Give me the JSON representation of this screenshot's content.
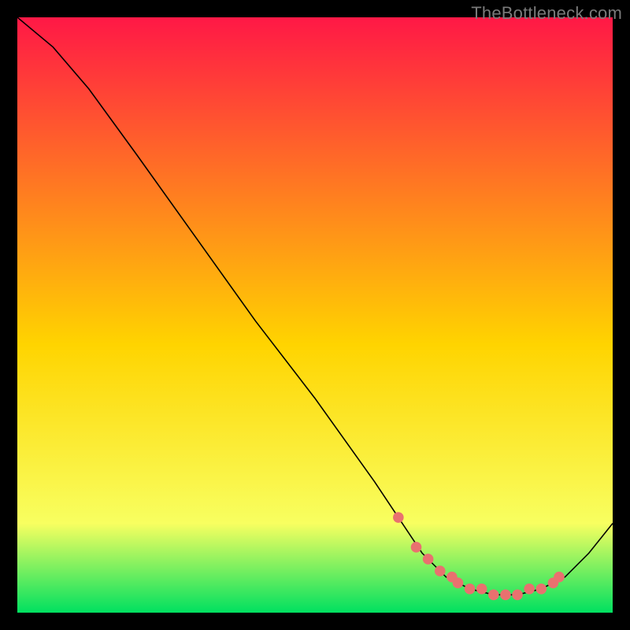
{
  "watermark": "TheBottleneck.com",
  "colors": {
    "bg_black": "#000000",
    "grad_top": "#ff1846",
    "grad_mid": "#ffd400",
    "grad_low": "#f8ff60",
    "grad_bottom": "#00e060",
    "curve": "#000000",
    "marker": "#e9716f",
    "watermark": "#7a7a7a"
  },
  "chart_data": {
    "type": "line",
    "title": "",
    "xlabel": "",
    "ylabel": "",
    "xlim": [
      0,
      100
    ],
    "ylim": [
      0,
      100
    ],
    "series": [
      {
        "name": "curve",
        "x": [
          0,
          6,
          12,
          20,
          30,
          40,
          50,
          60,
          64,
          68,
          72,
          76,
          80,
          84,
          88,
          92,
          96,
          100
        ],
        "values": [
          100,
          95,
          88,
          77,
          63,
          49,
          36,
          22,
          16,
          10,
          6,
          4,
          3,
          3,
          4,
          6,
          10,
          15
        ]
      }
    ],
    "markers": {
      "name": "highlighted-points",
      "x": [
        64,
        67,
        69,
        71,
        73,
        74,
        76,
        78,
        80,
        82,
        84,
        86,
        88,
        90,
        91
      ],
      "values": [
        16,
        11,
        9,
        7,
        6,
        5,
        4,
        4,
        3,
        3,
        3,
        4,
        4,
        5,
        6
      ]
    }
  }
}
